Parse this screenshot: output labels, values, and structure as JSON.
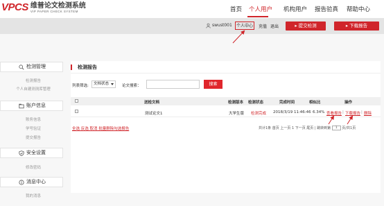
{
  "header": {
    "logo_mark": "VPCS",
    "logo_cn": "维普论文检测系统",
    "logo_en": "VIP PAPER CHECK SYSTEM",
    "nav": [
      "首页",
      "个人用户",
      "机构用户",
      "报告验真",
      "帮助中心"
    ],
    "active_nav": "个人用户"
  },
  "subbar": {
    "username": "swust001",
    "center_link": "个人中心",
    "recharge": "充值",
    "logout": "退出",
    "submit_button": "提交检测",
    "download_button": "下载报告"
  },
  "sidebar": {
    "sections": [
      {
        "title": "检测管理",
        "icon": "search-icon",
        "items": [
          "检测报告",
          "个人自建测测库管理"
        ]
      },
      {
        "title": "账户信息",
        "icon": "folder-icon",
        "items": [
          "账务信息",
          "学号验证",
          "提交报告"
        ]
      },
      {
        "title": "安全设置",
        "icon": "shield-icon",
        "items": [
          "修改密码"
        ]
      },
      {
        "title": "消息中心",
        "icon": "info-icon",
        "items": [
          "我的消息"
        ]
      }
    ]
  },
  "main": {
    "title": "检测报告",
    "filter_label": "列表筛选:",
    "status_select": "文档状态",
    "search_label": "论文搜索：",
    "search_value": "",
    "search_button": "搜索",
    "columns": [
      "送检文档",
      "检测版本",
      "检测状态",
      "完成时间",
      "相似比",
      "操作"
    ],
    "rows": [
      {
        "doc": "测试论文1",
        "version": "大学生版",
        "status": "检测完成",
        "time": "2018/3/19 11:46:46",
        "ratio": "6.34%",
        "actions": [
          "查看报告",
          "下载报告",
          "删除"
        ]
      }
    ],
    "bulk_actions": "全选 反选 取消 批量删除勾选报告",
    "pager_text": "共计1条 首页 上一页 1 下一页 尾页 | 跳转到第",
    "pager_page": "1",
    "pager_suffix": "页/共1页"
  },
  "colors": {
    "brand_red": "#d0252a",
    "status_green": "#e05a4f"
  }
}
